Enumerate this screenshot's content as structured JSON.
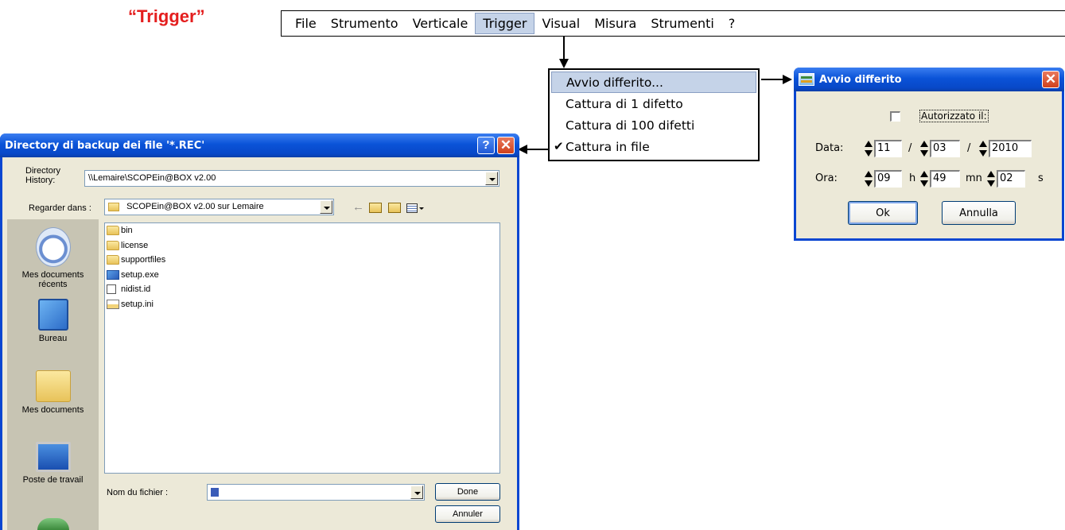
{
  "heading": "“Trigger”",
  "menubar": {
    "items": [
      "File",
      "Strumento",
      "Verticale",
      "Trigger",
      "Visual",
      "Misura",
      "Strumenti",
      "?"
    ],
    "active_index": 3
  },
  "trigger_menu": {
    "items": [
      {
        "label": "Avvio differito...",
        "highlighted": true,
        "checked": false
      },
      {
        "label": "Cattura di 1 difetto",
        "highlighted": false,
        "checked": false
      },
      {
        "label": "Cattura di 100 difetti",
        "highlighted": false,
        "checked": false
      },
      {
        "label": "Cattura in file",
        "highlighted": false,
        "checked": true
      }
    ]
  },
  "avvio_dialog": {
    "title": "Avvio differito",
    "authorized_label": "Autorizzato il:",
    "authorized_checked": false,
    "date_label": "Data:",
    "date_day": "11",
    "date_sep1": "/",
    "date_month": "03",
    "date_sep2": "/",
    "date_year": "2010",
    "time_label": "Ora:",
    "hour": "09",
    "hour_unit": "h",
    "minute": "49",
    "minute_unit": "mn",
    "second": "02",
    "second_unit": "s",
    "ok_button": "Ok",
    "cancel_button": "Annulla"
  },
  "file_dialog": {
    "title": "Directory di backup dei file '*.REC'",
    "help_glyph": "?",
    "history_label": "Directory History:",
    "history_value": "\\\\Lemaire\\SCOPEin@BOX v2.00",
    "lookin_label": "Regarder dans :",
    "lookin_value": "SCOPEin@BOX v2.00 sur Lemaire",
    "places": [
      "Mes documents récents",
      "Bureau",
      "Mes documents",
      "Poste de travail"
    ],
    "files": [
      {
        "name": "bin",
        "icon": "folder-icon"
      },
      {
        "name": "license",
        "icon": "folder-icon"
      },
      {
        "name": "supportfiles",
        "icon": "folder-icon"
      },
      {
        "name": "setup.exe",
        "icon": "setup-exe-icon"
      },
      {
        "name": "nidist.id",
        "icon": "id-file-icon"
      },
      {
        "name": "setup.ini",
        "icon": "ini-file-icon"
      }
    ],
    "filename_label": "Nom du fichier :",
    "filename_value": "",
    "done_button": "Done",
    "cancel_button": "Annuler"
  }
}
